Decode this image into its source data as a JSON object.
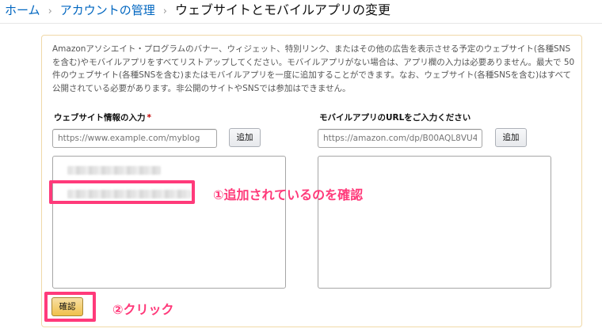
{
  "breadcrumb": {
    "home": "ホーム",
    "account": "アカウントの管理",
    "current": "ウェブサイトとモバイルアプリの変更",
    "separator": "›"
  },
  "description": "Amazonアソシエイト・プログラムのバナー、ウィジェット、特別リンク、またはその他の広告を表示させる予定のウェブサイト(各種SNSを含む)やモバイルアプリをすべてリストアップしてください。モバイルアプリがない場合は、アプリ欄の入力は必要ありません。最大で 50 件のウェブサイト(各種SNSを含む)またはモバイルアプリを一度に追加することができます。なお、ウェブサイト(各種SNSを含む)はすべて公開されている必要があります。非公開のサイトやSNSでは参加はできません。",
  "website": {
    "label": "ウェブサイト情報の入力",
    "required_mark": "*",
    "placeholder": "https://www.example.com/myblog",
    "add_label": "追加"
  },
  "mobile": {
    "label": "モバイルアプリのURLをご入力ください",
    "placeholder": "https://amazon.com/dp/B00AQL8VU4",
    "add_label": "追加"
  },
  "annotations": {
    "step1": "①追加されているのを確認",
    "step2": "②クリック"
  },
  "confirm_label": "確認",
  "colors": {
    "accent": "#ff3a7a",
    "link": "#0066c0",
    "panel_border": "#f0d9a8",
    "confirm_button": "#f0c14b"
  }
}
